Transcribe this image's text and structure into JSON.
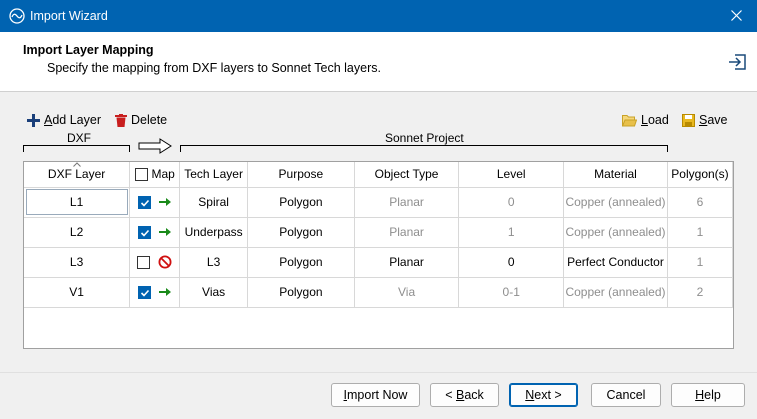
{
  "window": {
    "title": "Import Wizard"
  },
  "header": {
    "title": "Import Layer Mapping",
    "subtitle": "Specify the mapping from DXF layers to Sonnet Tech layers."
  },
  "toolbar": {
    "add_layer_label": "dd Layer",
    "add_layer_accel": "A",
    "delete_label": "Delete",
    "load_label": "oad",
    "load_accel": "L",
    "save_label": "ave",
    "save_accel": "S"
  },
  "groups": {
    "dxf": "DXF",
    "sonnet": "Sonnet Project"
  },
  "table": {
    "columns": [
      "DXF Layer",
      "Map",
      "Tech Layer",
      "Purpose",
      "Object Type",
      "Level",
      "Material",
      "Polygon(s)"
    ],
    "rows": [
      {
        "dxf": "L1",
        "map": true,
        "tech": "Spiral",
        "purpose": "Polygon",
        "object_type": "Planar",
        "level": "0",
        "material": "Copper (annealed)",
        "polygons": "6"
      },
      {
        "dxf": "L2",
        "map": true,
        "tech": "Underpass",
        "purpose": "Polygon",
        "object_type": "Planar",
        "level": "1",
        "material": "Copper (annealed)",
        "polygons": "1"
      },
      {
        "dxf": "L3",
        "map": false,
        "tech": "L3",
        "purpose": "Polygon",
        "object_type": "Planar",
        "level": "0",
        "material": "Perfect Conductor",
        "polygons": "1"
      },
      {
        "dxf": "V1",
        "map": true,
        "tech": "Vias",
        "purpose": "Polygon",
        "object_type": "Via",
        "level": "0-1",
        "material": "Copper (annealed)",
        "polygons": "2"
      }
    ]
  },
  "buttons": {
    "import_now_accel": "I",
    "import_now_label": "mport Now",
    "back_label": "< ",
    "back_accel": "B",
    "back_rest": "ack",
    "next_accel": "N",
    "next_label": "ext >",
    "cancel_label": "Cancel",
    "help_accel": "H",
    "help_label": "elp"
  },
  "colors": {
    "titlebar": "#0063b1",
    "check": "#0063b1",
    "arrow_green": "#1a8a1a",
    "no_red": "#d01010",
    "delete_red": "#c81e1e",
    "folder_yellow": "#e8c04a"
  }
}
